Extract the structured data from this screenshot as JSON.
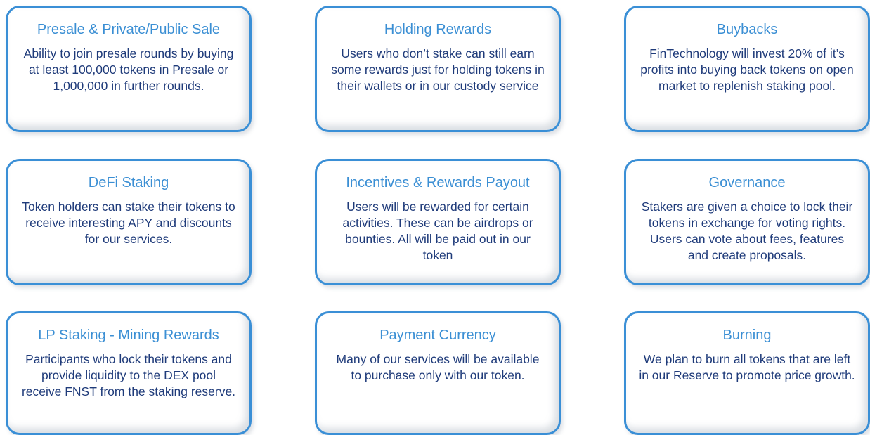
{
  "accent_color": "#3a8fd6",
  "title_color": "#3b8fd4",
  "text_color": "#1f3b7a",
  "cards": [
    {
      "title": "Presale & Private/Public Sale",
      "text": "Ability to join presale rounds by buying at least 100,000 tokens in Presale or 1,000,000 in further rounds."
    },
    {
      "title": "Holding Rewards",
      "text": "Users who don’t stake can still earn some rewards just for holding tokens in their wallets or in our custody service"
    },
    {
      "title": "Buybacks",
      "text": "FinTechnology will invest 20% of it’s profits into buying back tokens on open market to replenish staking pool."
    },
    {
      "title": "DeFi Staking",
      "text": "Token holders can stake their tokens to receive interesting APY and discounts for our services."
    },
    {
      "title": "Incentives & Rewards Payout",
      "text": "Users will be rewarded for certain activities. These can be airdrops or bounties. All will be paid out in our token"
    },
    {
      "title": "Governance",
      "text": "Stakers are given a choice to lock their tokens in exchange for voting rights. Users can vote about fees, features and create proposals."
    },
    {
      "title": "LP Staking - Mining Rewards",
      "text": "Participants who lock their tokens and provide liquidity to the DEX pool receive FNST from the staking reserve."
    },
    {
      "title": "Payment Currency",
      "text": "Many of our services will be available to purchase only with our token."
    },
    {
      "title": "Burning",
      "text": "We plan to burn all tokens that are left in our Reserve to promote price growth."
    }
  ]
}
